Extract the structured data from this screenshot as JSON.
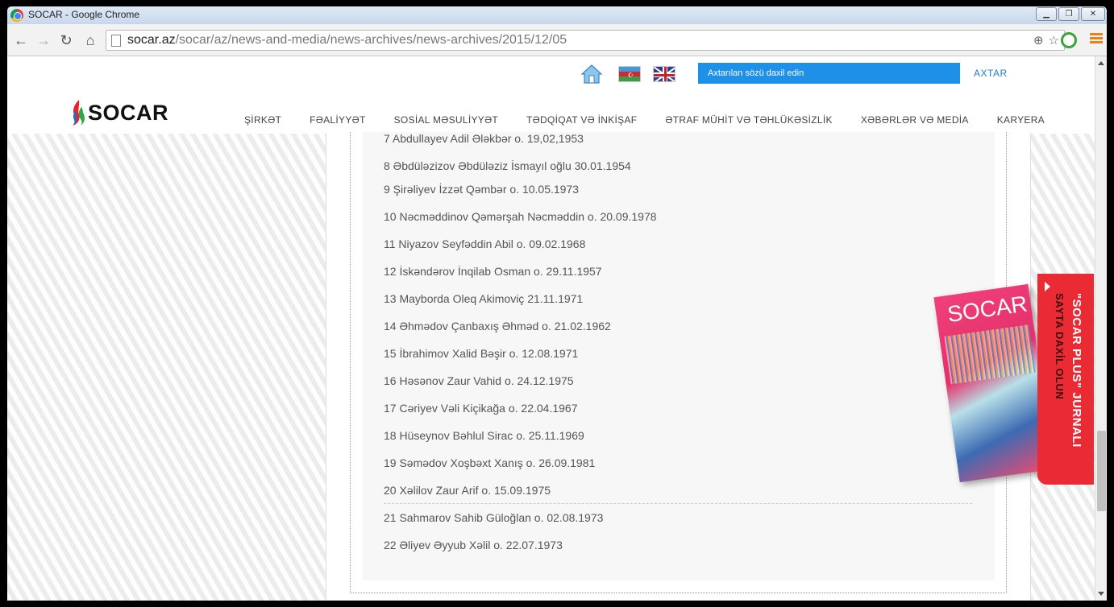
{
  "window": {
    "title": "SOCAR - Google Chrome"
  },
  "browser": {
    "url_host": "socar.az",
    "url_path": "/socar/az/news-and-media/news-archives/news-archives/2015/12/05"
  },
  "header": {
    "search_placeholder": "Axtarılan sözü daxil edin",
    "search_button": "AXTAR",
    "logo_text": "SOCAR",
    "nav": [
      "ŞİRKƏT",
      "FƏALİYYƏT",
      "SOSİAL MƏSULİYYƏT",
      "TƏDQİQAT VƏ İNKİŞAF",
      "ƏTRAF MÜHİT VƏ TƏHLÜKƏSİZLİK",
      "XƏBƏRLƏR VƏ MEDİA",
      "KARYERA"
    ]
  },
  "list": [
    "7 Abdullayev Adil Ələkbər o. 19,02,1953",
    "8 Əbdüləzizov Əbdüləziz İsmayıl oğlu 30.01.1954",
    "9 Şirəliyev İzzət Qəmbər o. 10.05.1973",
    "10 Nəcməddinov Qəmərşah Nəcməddin o. 20.09.1978",
    "11 Niyazov Seyfəddin Abil o. 09.02.1968",
    "12 İskəndərov İnqilab Osman o. 29.11.1957",
    "13 Mayborda Oleq Akimoviç 21.11.1971",
    "14 Əhmədov Çanbaxış Əhməd o. 21.02.1962",
    "15 İbrahimov Xalid Bəşir o. 12.08.1971",
    "16 Həsənov Zaur Vahid o. 24.12.1975",
    "17 Cəriyev Vəli Kiçikağa o. 22.04.1967",
    "18 Hüseynov Bəhlul Sirac o. 25.11.1969",
    "19 Səmədov Xoşbəxt Xanış o. 26.09.1981",
    "20 Xəlilov Zaur Arif o. 15.09.1975",
    "21 Sahmarov Sahib Güloğlan o. 02.08.1973",
    "22 Əliyev Əyyub Xəlil o. 22.07.1973"
  ],
  "promo": {
    "magazine_title": "SOCAR",
    "line1": "\"SOCAR PLUS\" JURNALI",
    "line2": "SAYTA DAXİL OLUN"
  },
  "colors": {
    "search_bg": "#1e90e8",
    "promo_red": "#ea2b34",
    "link_blue": "#2a7ec6"
  }
}
